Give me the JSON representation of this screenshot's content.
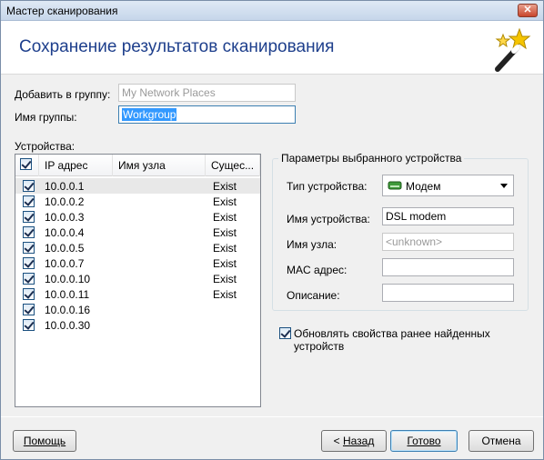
{
  "window": {
    "title": "Мастер сканирования",
    "close_glyph": "✕"
  },
  "header": {
    "title": "Сохранение результатов сканирования",
    "icon": "magic-wand-icon"
  },
  "form": {
    "add_to_group_label": "Добавить в группу:",
    "add_to_group_value": "My Network Places",
    "group_name_label": "Имя группы:",
    "group_name_value": "Workgroup"
  },
  "devices": {
    "label": "Устройства:",
    "columns": [
      "IP адрес",
      "Имя узла",
      "Сущес..."
    ],
    "rows": [
      {
        "ip": "10.0.0.1",
        "status": "Exist",
        "checked": true
      },
      {
        "ip": "10.0.0.2",
        "status": "Exist",
        "checked": true
      },
      {
        "ip": "10.0.0.3",
        "status": "Exist",
        "checked": true
      },
      {
        "ip": "10.0.0.4",
        "status": "Exist",
        "checked": true
      },
      {
        "ip": "10.0.0.5",
        "status": "Exist",
        "checked": true
      },
      {
        "ip": "10.0.0.7",
        "status": "Exist",
        "checked": true
      },
      {
        "ip": "10.0.0.10",
        "status": "Exist",
        "checked": true
      },
      {
        "ip": "10.0.0.11",
        "status": "Exist",
        "checked": true
      },
      {
        "ip": "10.0.0.16",
        "status": "",
        "checked": true
      },
      {
        "ip": "10.0.0.30",
        "status": "",
        "checked": true
      }
    ]
  },
  "params": {
    "group_title": "Параметры выбранного устройства",
    "type_label": "Тип устройства:",
    "type_value": "Модем",
    "name_label": "Имя устройства:",
    "name_value": "DSL modem",
    "host_label": "Имя узла:",
    "host_value": "<unknown>",
    "mac_label": "MAC адрес:",
    "mac_value": "",
    "desc_label": "Описание:",
    "desc_value": ""
  },
  "update_checkbox": {
    "label": "Обновлять свойства ранее найденных устройств",
    "checked": true
  },
  "buttons": {
    "help_label": "Помощь",
    "back_arrow": "< ",
    "back_label": "Назад",
    "done_label": "Готово",
    "cancel_label": "Отмена"
  },
  "colors": {
    "heading": "#1e3f8c",
    "selection": "#3399ff"
  }
}
